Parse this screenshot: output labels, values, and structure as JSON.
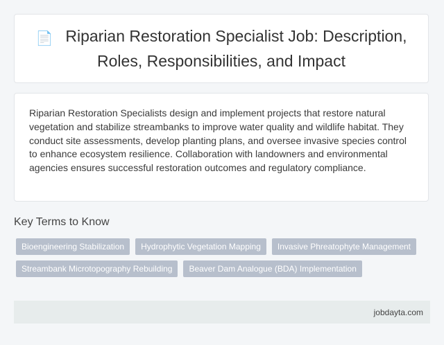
{
  "header": {
    "icon": "document-icon",
    "title": "Riparian Restoration Specialist Job: Description, Roles, Responsibilities, and Impact"
  },
  "description": "Riparian Restoration Specialists design and implement projects that restore natural vegetation and stabilize streambanks to improve water quality and wildlife habitat. They conduct site assessments, develop planting plans, and oversee invasive species control to enhance ecosystem resilience. Collaboration with landowners and environmental agencies ensures successful restoration outcomes and regulatory compliance.",
  "key_terms": {
    "heading": "Key Terms to Know",
    "tags": [
      "Bioengineering Stabilization",
      "Hydrophytic Vegetation Mapping",
      "Invasive Phreatophyte Management",
      "Streambank Microtopography Rebuilding",
      "Beaver Dam Analogue (BDA) Implementation"
    ]
  },
  "footer": {
    "site": "jobdayta.com"
  },
  "colors": {
    "tag_background": "#b7bfcc",
    "footer_background": "#e7ecec",
    "page_background": "#f4f6f8"
  }
}
